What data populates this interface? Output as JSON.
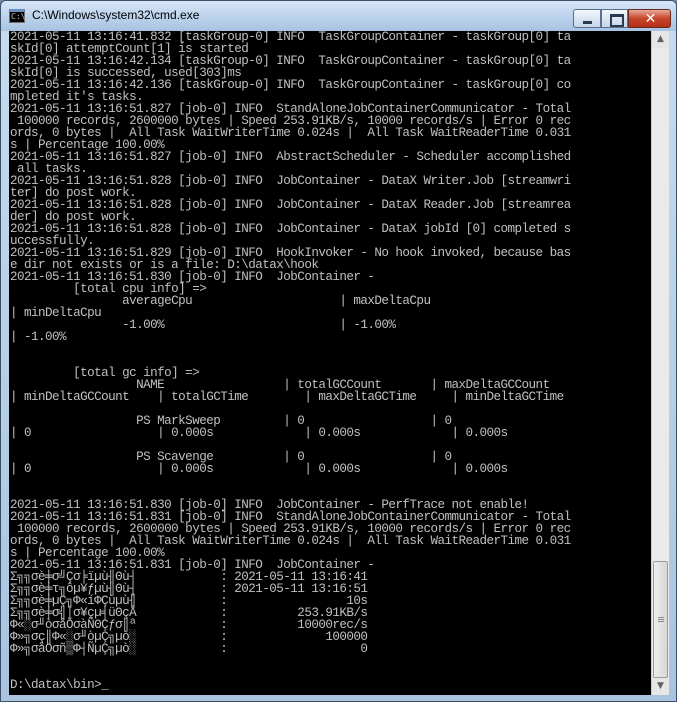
{
  "window": {
    "title": "C:\\Windows\\system32\\cmd.exe",
    "icon_text": "C:\\",
    "close_glyph": "✕"
  },
  "icons": {
    "app": "console-icon",
    "minimize": "minimize-icon",
    "maximize": "maximize-icon",
    "close": "close-icon",
    "scroll_up": "arrow-up-icon",
    "scroll_down": "arrow-down-icon"
  },
  "colors": {
    "console_bg": "#000000",
    "console_text": "#c0c0c0",
    "close_button": "#c7452c"
  },
  "console": {
    "lines": [
      "2021-05-11 13:16:41.832 [taskGroup-0] INFO  TaskGroupContainer - taskGroup[0] ta",
      "skId[0] attemptCount[1] is started",
      "2021-05-11 13:16:42.134 [taskGroup-0] INFO  TaskGroupContainer - taskGroup[0] ta",
      "skId[0] is successed, used[303]ms",
      "2021-05-11 13:16:42.136 [taskGroup-0] INFO  TaskGroupContainer - taskGroup[0] co",
      "mpleted it's tasks.",
      "2021-05-11 13:16:51.827 [job-0] INFO  StandAloneJobContainerCommunicator - Total",
      " 100000 records, 2600000 bytes | Speed 253.91KB/s, 10000 records/s | Error 0 rec",
      "ords, 0 bytes |  All Task WaitWriterTime 0.024s |  All Task WaitReaderTime 0.031",
      "s | Percentage 100.00%",
      "2021-05-11 13:16:51.827 [job-0] INFO  AbstractScheduler - Scheduler accomplished",
      " all tasks.",
      "2021-05-11 13:16:51.828 [job-0] INFO  JobContainer - DataX Writer.Job [streamwri",
      "ter] do post work.",
      "2021-05-11 13:16:51.828 [job-0] INFO  JobContainer - DataX Reader.Job [streamrea",
      "der] do post work.",
      "2021-05-11 13:16:51.828 [job-0] INFO  JobContainer - DataX jobId [0] completed s",
      "uccessfully.",
      "2021-05-11 13:16:51.829 [job-0] INFO  HookInvoker - No hook invoked, because bas",
      "e dir not exists or is a file: D:\\datax\\hook",
      "2021-05-11 13:16:51.830 [job-0] INFO  JobContainer -",
      "         [total cpu info] =>",
      "                averageCpu                     | maxDeltaCpu",
      "| minDeltaCpu",
      "                -1.00%                         | -1.00%",
      "| -1.00%",
      "",
      "",
      "         [total gc info] =>",
      "                  NAME                 | totalGCCount       | maxDeltaGCCount",
      "| minDeltaGCCount    | totalGCTime        | maxDeltaGCTime     | minDeltaGCTime",
      "",
      "                  PS MarkSweep         | 0                  | 0",
      "| 0                  | 0.000s             | 0.000s             | 0.000s",
      "",
      "                  PS Scavenge          | 0                  | 0",
      "| 0                  | 0.000s             | 0.000s             | 0.000s",
      "",
      "",
      "2021-05-11 13:16:51.830 [job-0] INFO  JobContainer - PerfTrace not enable!",
      "2021-05-11 13:16:51.831 [job-0] INFO  StandAloneJobContainerCommunicator - Total",
      " 100000 records, 2600000 bytes | Speed 253.91KB/s, 10000 records/s | Error 0 rec",
      "ords, 0 bytes |  All Task WaitWriterTime 0.024s |  All Task WaitReaderTime 0.031",
      "s | Percentage 100.00%",
      "2021-05-11 13:16:51.831 [job-0] INFO  JobContainer -",
      "Σ╗╗σè╪σ╝Çσ╞ïµù╢Θù┤            : 2021-05-11 13:16:41",
      "Σ╗╗σè╪τ╗ôµ¥ƒµù╢Θù┤            : 2021-05-11 13:16:51",
      "Σ╗╗σè╪µÇ╗Φ«íΦÇùµù╢            :                 10s",
      "Σ╗╗σè╪σ╣│σ¥çµ╡üΘçÅ            :          253.91KB/s",
      "Φ«░σ╜òσåÖσàÑΘÇƒσ║ª            :          10000rec/s",
      "Φ»╗σç║Φ«░σ╜òµÇ╗µò░            :              100000",
      "Φ»╗σåÖσñ▒Φ┤ÑµÇ╗µò░            :                   0",
      "",
      "",
      "D:\\datax\\bin>_"
    ]
  }
}
